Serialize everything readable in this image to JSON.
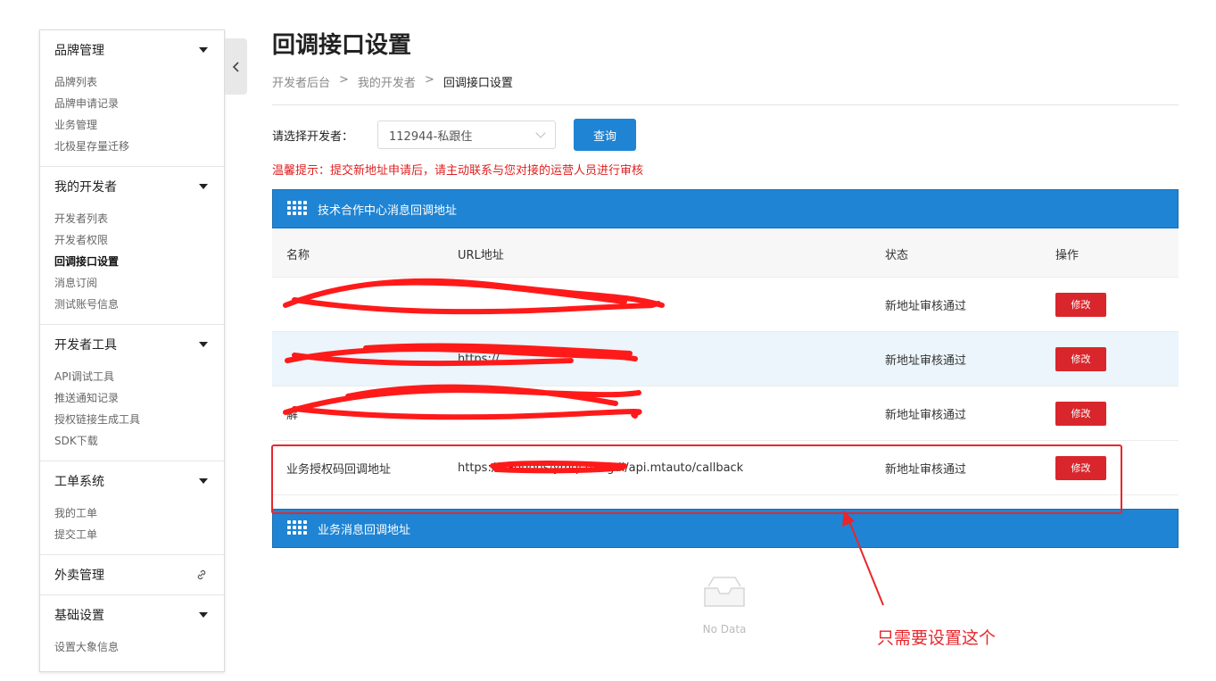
{
  "sidebar": {
    "groups": [
      {
        "title": "品牌管理",
        "items": [
          "品牌列表",
          "品牌申请记录",
          "业务管理",
          "北极星存量迁移"
        ]
      },
      {
        "title": "我的开发者",
        "items": [
          "开发者列表",
          "开发者权限",
          "回调接口设置",
          "消息订阅",
          "测试账号信息"
        ]
      },
      {
        "title": "开发者工具",
        "items": [
          "API调试工具",
          "推送通知记录",
          "授权链接生成工具",
          "SDK下载"
        ]
      },
      {
        "title": "工单系统",
        "items": [
          "我的工单",
          "提交工单"
        ]
      },
      {
        "title": "外卖管理",
        "items": []
      },
      {
        "title": "基础设置",
        "items": [
          "设置大象信息"
        ]
      }
    ],
    "collapse_icon": "chevron-left-icon"
  },
  "page": {
    "title": "回调接口设置",
    "breadcrumb": [
      "开发者后台",
      "我的开发者",
      "回调接口设置"
    ],
    "breadcrumb_sep": ">"
  },
  "filter": {
    "label": "请选择开发者：",
    "selected": "112944-私跟住",
    "query_label": "查询"
  },
  "warning": "温馨提示：提交新地址申请后，请主动联系与您对接的运营人员进行审核",
  "panel1": {
    "title": "技术合作中心消息回调地址",
    "headers": [
      "名称",
      "URL地址",
      "状态",
      "操作"
    ],
    "rows": [
      {
        "name": "",
        "url": "",
        "status": "新地址审核通过",
        "action": "修改"
      },
      {
        "name": "",
        "url": "https://",
        "status": "新地址审核通过",
        "action": "修改"
      },
      {
        "name": "解",
        "url": "",
        "status": "新地址审核通过",
        "action": "修改"
      },
      {
        "name": "业务授权码回调地址",
        "url": "https://                                    /addons/ymqchangdi/api.mtauto/callback",
        "status": "新地址审核通过",
        "action": "修改"
      }
    ]
  },
  "panel2": {
    "title": "业务消息回调地址",
    "empty_text": "No Data"
  },
  "annotation": "只需要设置这个",
  "colors": {
    "primary": "#1f84d3",
    "danger": "#d9262c",
    "annotation": "#e8262c"
  }
}
